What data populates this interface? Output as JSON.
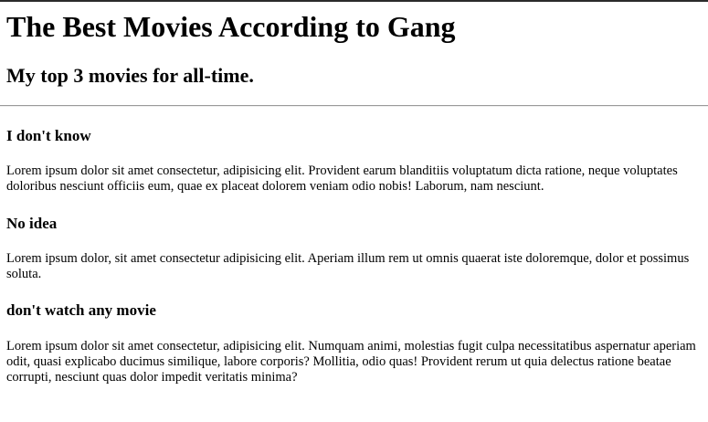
{
  "header": {
    "title": "The Best Movies According to Gang",
    "subtitle": "My top 3 movies for all-time."
  },
  "movies": [
    {
      "title": "I don't know",
      "description": "Lorem ipsum dolor sit amet consectetur, adipisicing elit. Provident earum blanditiis voluptatum dicta ratione, neque voluptates doloribus nesciunt officiis eum, quae ex placeat dolorem veniam odio nobis! Laborum, nam nesciunt."
    },
    {
      "title": "No idea",
      "description": "Lorem ipsum dolor, sit amet consectetur adipisicing elit. Aperiam illum rem ut omnis quaerat iste doloremque, dolor et possimus soluta."
    },
    {
      "title": "don't watch any movie",
      "description": "Lorem ipsum dolor sit amet consectetur, adipisicing elit. Numquam animi, molestias fugit culpa necessitatibus aspernatur aperiam odit, quasi explicabo ducimus similique, labore corporis? Mollitia, odio quas! Provident rerum ut quia delectus ratione beatae corrupti, nesciunt quas dolor impedit veritatis minima?"
    }
  ]
}
